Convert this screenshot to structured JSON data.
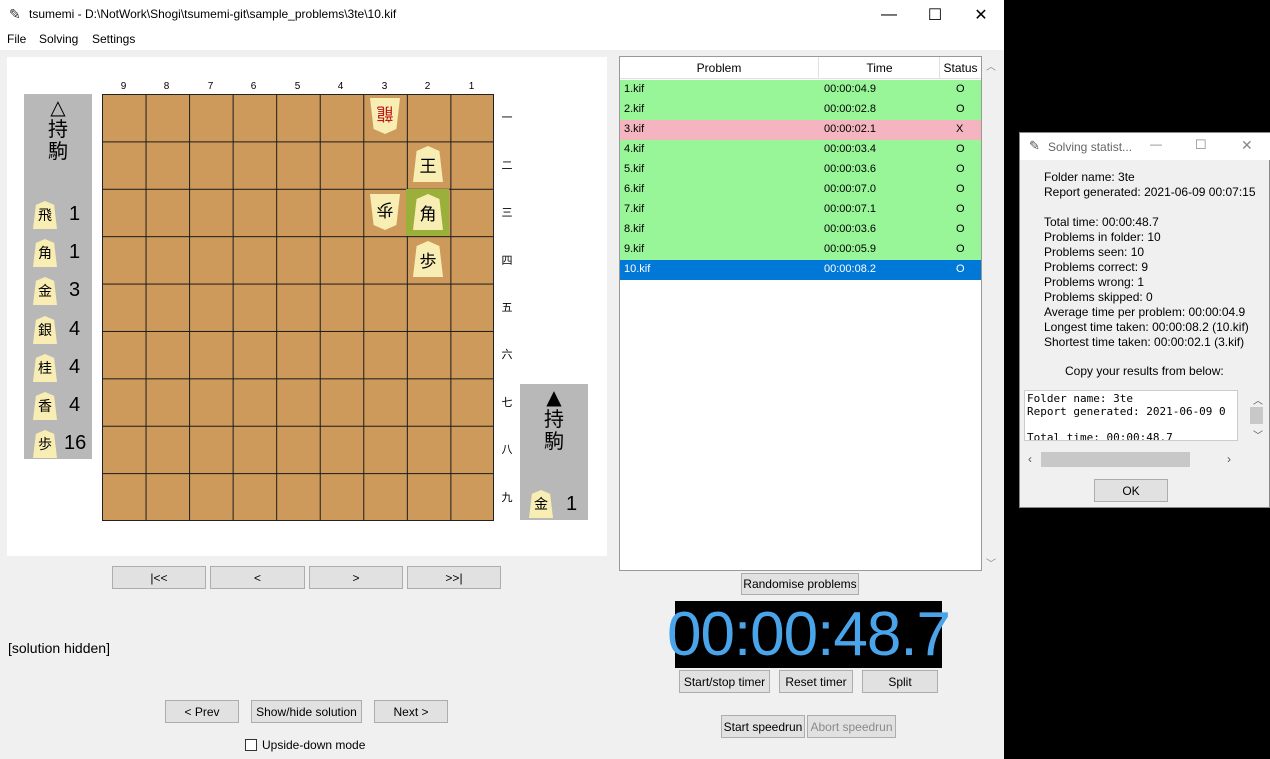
{
  "window": {
    "title": "tsumemi - D:\\NotWork\\Shogi\\tsumemi-git\\sample_problems\\3te\\10.kif",
    "feather": "✎",
    "minimize": "—",
    "maximize": "☐",
    "close": "✕"
  },
  "menu": [
    "File",
    "Solving",
    "Settings"
  ],
  "board": {
    "cols": [
      "9",
      "8",
      "7",
      "6",
      "5",
      "4",
      "3",
      "2",
      "1"
    ],
    "rows": [
      "一",
      "二",
      "三",
      "四",
      "五",
      "六",
      "七",
      "八",
      "九"
    ],
    "pieces": [
      {
        "char": "龍",
        "red": true,
        "rotated": true
      },
      {
        "char": "王"
      },
      {
        "char": "歩",
        "rotated": true
      },
      {
        "char": "角"
      },
      {
        "char": "歩"
      }
    ]
  },
  "gote_hand": {
    "header": [
      "△",
      "持",
      "駒"
    ],
    "pieces": [
      {
        "char": "飛",
        "count": "1"
      },
      {
        "char": "角",
        "count": "1"
      },
      {
        "char": "金",
        "count": "3"
      },
      {
        "char": "銀",
        "count": "4"
      },
      {
        "char": "桂",
        "count": "4"
      },
      {
        "char": "香",
        "count": "4"
      },
      {
        "char": "歩",
        "count": "16"
      }
    ]
  },
  "sente_hand": {
    "header": [
      "▲",
      "持",
      "駒"
    ],
    "pieces": [
      {
        "char": "金",
        "count": "1"
      }
    ]
  },
  "nav": {
    "first": "|<<",
    "prev": "<",
    "next": ">",
    "last": ">>|"
  },
  "solution_text": "[solution hidden]",
  "controls": {
    "prev": "< Prev",
    "toggle": "Show/hide solution",
    "next": "Next >",
    "upside_down": "Upside-down mode"
  },
  "table": {
    "headers": {
      "problem": "Problem",
      "time": "Time",
      "status": "Status"
    },
    "rows": [
      {
        "problem": "1.kif",
        "time": "00:00:04.9",
        "status": "O"
      },
      {
        "problem": "2.kif",
        "time": "00:00:02.8",
        "status": "O"
      },
      {
        "problem": "3.kif",
        "time": "00:00:02.1",
        "status": "X"
      },
      {
        "problem": "4.kif",
        "time": "00:00:03.4",
        "status": "O"
      },
      {
        "problem": "5.kif",
        "time": "00:00:03.6",
        "status": "O"
      },
      {
        "problem": "6.kif",
        "time": "00:00:07.0",
        "status": "O"
      },
      {
        "problem": "7.kif",
        "time": "00:00:07.1",
        "status": "O"
      },
      {
        "problem": "8.kif",
        "time": "00:00:03.6",
        "status": "O"
      },
      {
        "problem": "9.kif",
        "time": "00:00:05.9",
        "status": "O"
      },
      {
        "problem": "10.kif",
        "time": "00:00:08.2",
        "status": "O"
      }
    ]
  },
  "randomise": "Randomise problems",
  "timer": {
    "value": "00:00:48.7",
    "start_stop": "Start/stop timer",
    "reset": "Reset timer",
    "split": "Split"
  },
  "speedrun": {
    "start": "Start speedrun",
    "abort": "Abort speedrun"
  },
  "dialog": {
    "title": "Solving statist...",
    "stats": [
      "Folder name: 3te",
      "Report generated: 2021-06-09 00:07:15",
      "",
      "Total time: 00:00:48.7",
      "Problems in folder: 10",
      "Problems seen: 10",
      "Problems correct: 9",
      "Problems wrong: 1",
      "Problems skipped: 0",
      "Average time per problem: 00:00:04.9",
      "Longest time taken: 00:00:08.2 (10.kif)",
      "Shortest time taken: 00:00:02.1 (3.kif)"
    ],
    "copy_label": "Copy your results from below:",
    "textarea": "Folder name: 3te\nReport generated: 2021-06-09 0\n\nTotal time: 00:00:48.7",
    "ok": "OK"
  }
}
